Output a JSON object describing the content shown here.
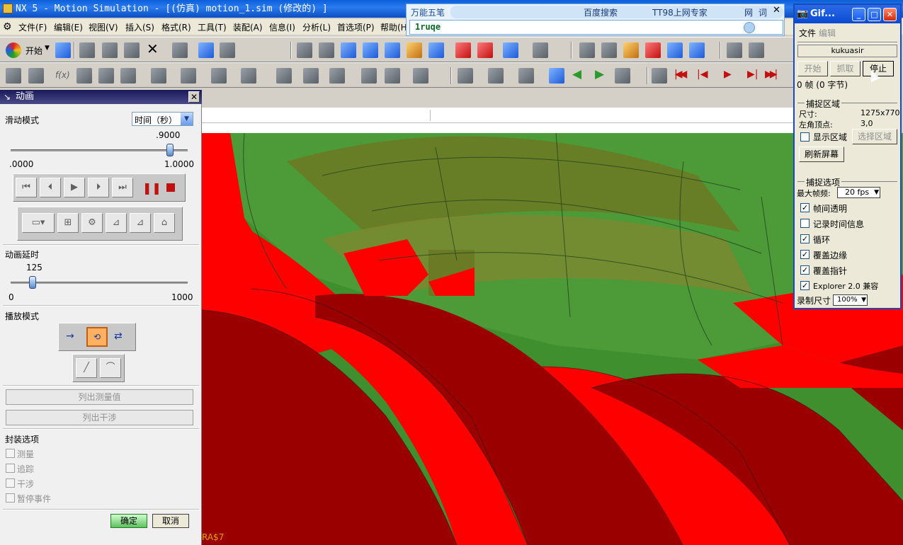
{
  "window": {
    "title": "NX 5 - Motion Simulation - [(仿真) motion_1.sim  (修改的) ]"
  },
  "menu": [
    {
      "label": "文件(F)"
    },
    {
      "label": "编辑(E)"
    },
    {
      "label": "视图(V)"
    },
    {
      "label": "插入(S)"
    },
    {
      "label": "格式(R)"
    },
    {
      "label": "工具(T)"
    },
    {
      "label": "装配(A)"
    },
    {
      "label": "信息(I)"
    },
    {
      "label": "分析(L)"
    },
    {
      "label": "首选项(P)"
    },
    {
      "label": "帮助(H"
    }
  ],
  "toolbar": {
    "start_label": "开始"
  },
  "ime": {
    "name": "万能五笔",
    "input": "1ruqe",
    "links": [
      "百度搜索",
      "TT98上网专家",
      "网",
      "词"
    ]
  },
  "animation_panel": {
    "title": "动画",
    "slide_mode_label": "滑动模式",
    "slide_mode_value": "时间（秒）",
    "time_value": ".9000",
    "time_min": ".0000",
    "time_max": "1.0000",
    "time_fraction": 0.9,
    "delay_label": "动画延时",
    "delay_value": "125",
    "delay_min": "0",
    "delay_max": "1000",
    "delay_fraction": 0.125,
    "play_mode_label": "播放模式",
    "list_measure_label": "列出测量值",
    "list_interference_label": "列出干涉",
    "envelope_label": "封装选项",
    "options": [
      {
        "label": "测量"
      },
      {
        "label": "追踪"
      },
      {
        "label": "干涉"
      },
      {
        "label": "暂停事件"
      }
    ],
    "ok_label": "确定",
    "cancel_label": "取消"
  },
  "gif_tool": {
    "title": "Gif...",
    "menu": [
      "文件",
      "编辑"
    ],
    "user": "kukuasir",
    "start_label": "开始",
    "capture_label": "抓取",
    "stop_label": "停止",
    "frames_text": "0 帧 (0 字节)",
    "capture_area_header": "捕捉区域",
    "size_label": "尺寸:",
    "size_value": "1275x770",
    "corner_label": "左角顶点:",
    "corner_value": "3,0",
    "show_area_label": "显示区域",
    "select_area_label": "选择区域",
    "refresh_label": "刷新屏幕",
    "capture_options_header": "捕捉选项",
    "max_fps_label": "最大帧频:",
    "max_fps_value": "20 fps",
    "checks": [
      {
        "label": "帧间透明",
        "checked": true
      },
      {
        "label": "记录时间信息",
        "checked": false
      },
      {
        "label": "循环",
        "checked": true
      },
      {
        "label": "覆盖边缘",
        "checked": true
      },
      {
        "label": "覆盖指针",
        "checked": true
      },
      {
        "label": "Explorer 2.0 兼容",
        "checked": true
      }
    ],
    "record_size_label": "录制尺寸",
    "record_size_value": "100%"
  },
  "viewport": {
    "corner_text": "RA$7"
  },
  "colors": {
    "red": "#ff0000",
    "dark_red": "#9a0000",
    "green": "#3a8a2a",
    "olive": "#6a7a20"
  }
}
